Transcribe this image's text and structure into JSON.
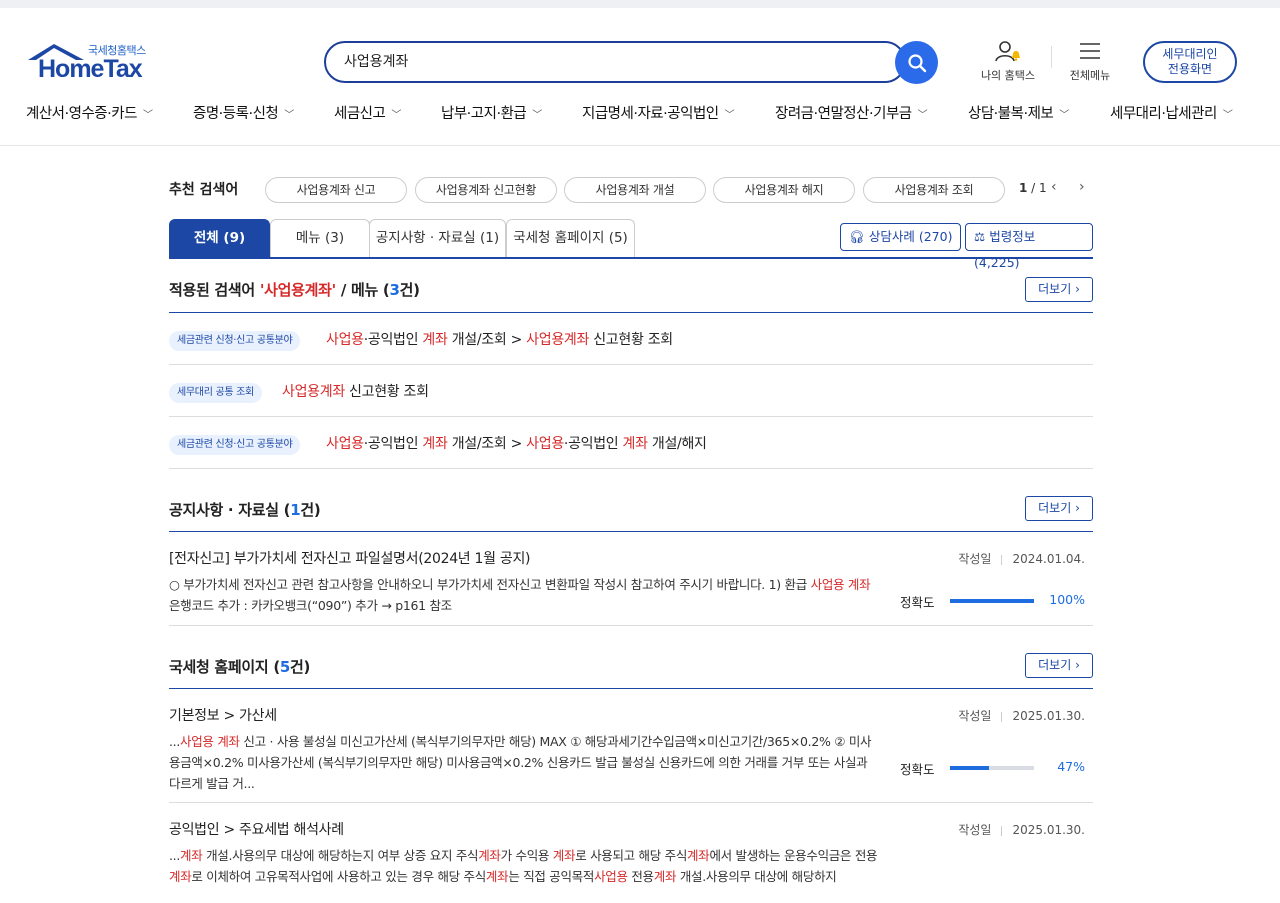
{
  "header": {
    "logo_sub": "국세청홈택스",
    "logo_main": "HomeTax",
    "search_value": "사업용계좌",
    "my_hometax": "나의 홈택스",
    "all_menu": "전체메뉴",
    "agent_btn_line1": "세무대리인",
    "agent_btn_line2": "전용화면"
  },
  "gnb": [
    {
      "label": "계산서·영수증·카드"
    },
    {
      "label": "증명·등록·신청"
    },
    {
      "label": "세금신고"
    },
    {
      "label": "납부·고지·환급"
    },
    {
      "label": "지급명세·자료·공익법인"
    },
    {
      "label": "장려금·연말정산·기부금"
    },
    {
      "label": "상담·불복·제보"
    },
    {
      "label": "세무대리·납세관리"
    }
  ],
  "recommend": {
    "label": "추천 검색어",
    "chips": [
      "사업용계좌 신고",
      "사업용계좌 신고현황",
      "사업용계좌 개설",
      "사업용계좌 해지",
      "사업용계좌 조회"
    ],
    "page_current": "1",
    "page_sep": " / ",
    "page_total": "1"
  },
  "tabs": [
    {
      "label": "전체 (9)"
    },
    {
      "label": "메뉴 (3)"
    },
    {
      "label": "공지사항 · 자료실 (1)"
    },
    {
      "label": "국세청 홈페이지 (5)"
    }
  ],
  "side_buttons": {
    "consult": "상담사례 (270)",
    "law": "법령정보 (4,225)"
  },
  "menu_section": {
    "title_pre": "적용된 검색어 ",
    "title_hl": "'사업용계좌'",
    "title_mid": " / 메뉴 (",
    "count": "3",
    "title_post": "건)",
    "more": "더보기",
    "rows": [
      {
        "badge": "세금관련 신청·신고 공통분야",
        "parts": [
          [
            "사업용",
            "r"
          ],
          [
            "·공익법인 ",
            ""
          ],
          [
            "계좌",
            "r"
          ],
          [
            " 개설/조회 > ",
            ""
          ],
          [
            "사업용계좌",
            "r"
          ],
          [
            " 신고현황 조회",
            ""
          ]
        ]
      },
      {
        "badge": "세무대리 공통 조회",
        "parts": [
          [
            "사업용계좌",
            "r"
          ],
          [
            " 신고현황 조회",
            ""
          ]
        ]
      },
      {
        "badge": "세금관련 신청·신고 공통분야",
        "parts": [
          [
            "사업용",
            "r"
          ],
          [
            "·공익법인 ",
            ""
          ],
          [
            "계좌",
            "r"
          ],
          [
            " 개설/조회 > ",
            ""
          ],
          [
            "사업용",
            "r"
          ],
          [
            "·공익법인 ",
            ""
          ],
          [
            "계좌",
            "r"
          ],
          [
            " 개설/해지",
            ""
          ]
        ]
      }
    ]
  },
  "notice_section": {
    "title_pre": "공지사항 · 자료실 (",
    "count": "1",
    "title_post": "건)",
    "more": "더보기",
    "items": [
      {
        "title": "[전자신고] 부가가치세 전자신고 파일설명서(2024년 1월 공지)",
        "date_label": "작성일",
        "date": "2024.01.04.",
        "body": [
          [
            "○ 부가가치세 전자신고 관련 참고사항을 안내하오니 부가가치세 전자신고 변환파일 작성시 참고하여 주시기 바랍니다. 1) 환급 ",
            ""
          ],
          [
            "사업용",
            "r"
          ],
          [
            " ",
            ""
          ],
          [
            "계좌",
            "r"
          ],
          [
            " 은행코드 추가 : 카카오뱅크(“090”) 추가 → p161 참조",
            ""
          ]
        ],
        "acc_label": "정확도",
        "acc_value": "100%",
        "acc_ratio": 1.0
      }
    ]
  },
  "site_section": {
    "title_pre": "국세청 홈페이지 (",
    "count": "5",
    "title_post": "건)",
    "more": "더보기",
    "items": [
      {
        "title": "기본정보 > 가산세",
        "date_label": "작성일",
        "date": "2025.01.30.",
        "body": [
          [
            "...",
            ""
          ],
          [
            "사업용",
            "r"
          ],
          [
            " ",
            ""
          ],
          [
            "계좌",
            "r"
          ],
          [
            " 신고 · 사용 불성실 미신고가산세 (복식부기의무자만 해당) MAX ① 해당과세기간수입금액×미신고기간/365×0.2% ② 미사용금액×0.2% 미사용가산세 (복식부기의무자만 해당) 미사용금액×0.2% 신용카드 발급 불성실 신용카드에 의한 거래를 거부 또는 사실과 다르게 발급 거...",
            ""
          ]
        ],
        "acc_label": "정확도",
        "acc_value": "47%",
        "acc_ratio": 0.47
      },
      {
        "title": "공익법인 > 주요세법 해석사례",
        "date_label": "작성일",
        "date": "2025.01.30.",
        "body": [
          [
            "...",
            ""
          ],
          [
            "계좌",
            "r"
          ],
          [
            " 개설.사용의무 대상에 해당하는지 여부 상증 요지 주식",
            ""
          ],
          [
            "계좌",
            "r"
          ],
          [
            "가 수익용 ",
            ""
          ],
          [
            "계좌",
            "r"
          ],
          [
            "로 사용되고 해당 주식",
            ""
          ],
          [
            "계좌",
            "r"
          ],
          [
            "에서 발생하는 운용수익금은 전용",
            ""
          ],
          [
            "계좌",
            "r"
          ],
          [
            "로 이체하여 고유목적사업에 사용하고 있는 경우 해당 주식",
            ""
          ],
          [
            "계좌",
            "r"
          ],
          [
            "는 직접 공익목적",
            ""
          ],
          [
            "사업용",
            "r"
          ],
          [
            " 전용",
            ""
          ],
          [
            "계좌",
            "r"
          ],
          [
            " 개설.사용의무 대상에 해당하지",
            ""
          ]
        ]
      }
    ]
  }
}
